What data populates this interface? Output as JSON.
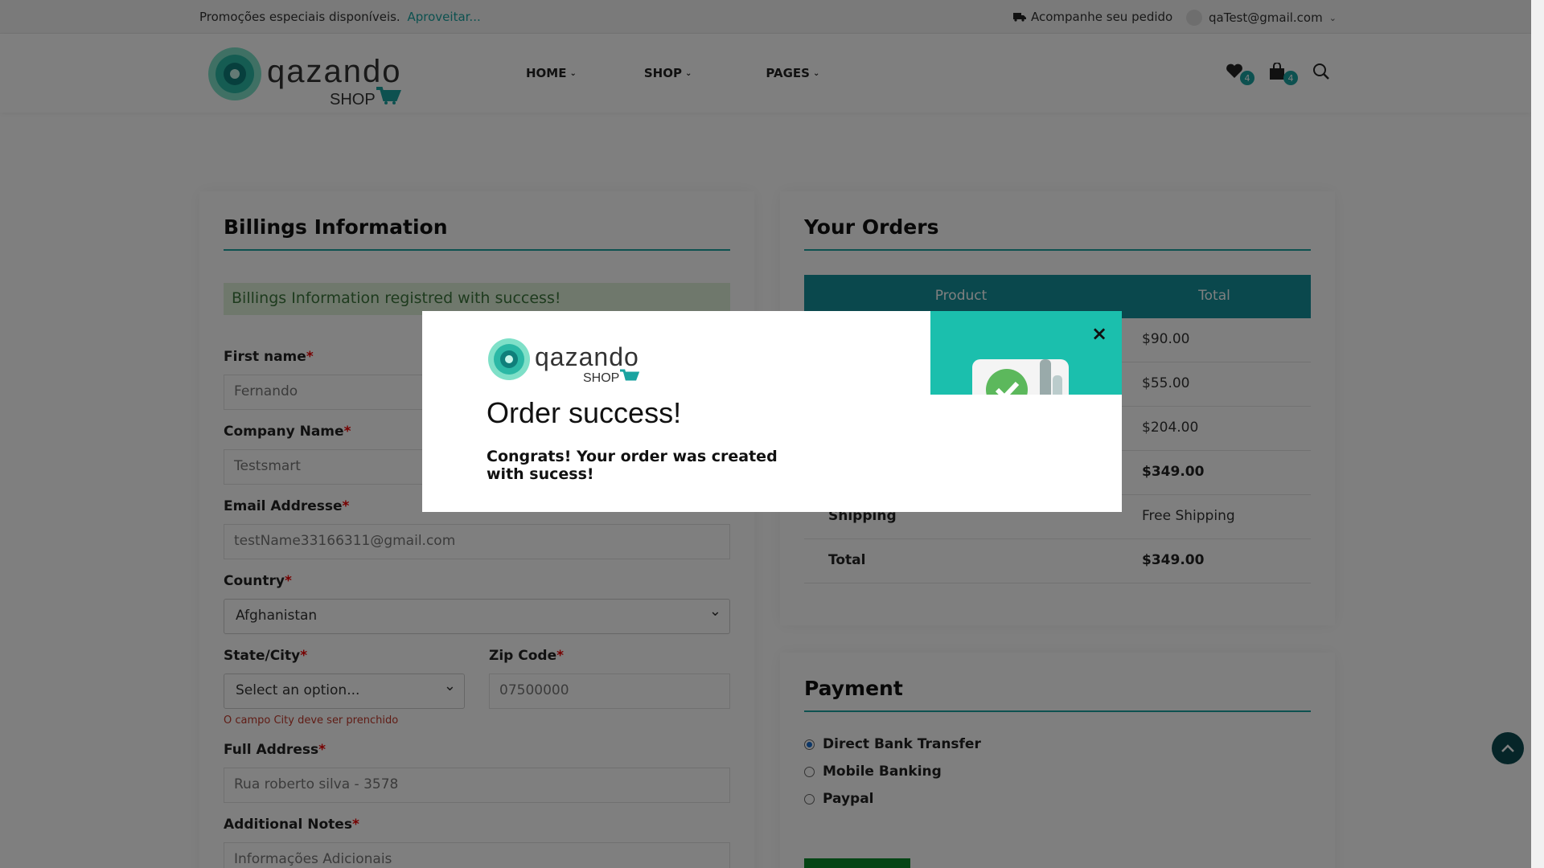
{
  "topbar": {
    "promo_text": "Promoções especiais disponíveis.",
    "promo_link": "Aproveitar...",
    "track_order": "Acompanhe seu pedido",
    "user_email": "qaTest@gmail.com"
  },
  "header": {
    "logo_text": "Qazando",
    "logo_sub": "SHOP",
    "nav": [
      "HOME",
      "SHOP",
      "PAGES"
    ],
    "wishlist_count": "4",
    "cart_count": "4"
  },
  "billing": {
    "title": "Billings Information",
    "success_message": "Billings Information registred with success!",
    "first_name_label": "First name",
    "first_name_value": "Fernando",
    "company_label": "Company Name",
    "company_value": "Testsmart",
    "email_label": "Email Addresse",
    "email_value": "testName33166311@gmail.com",
    "country_label": "Country",
    "country_value": "Afghanistan",
    "state_label": "State/City",
    "state_value": "Select an option...",
    "state_error": "O campo City deve ser prenchido",
    "zip_label": "Zip Code",
    "zip_value": "07500000",
    "address_label": "Full Address",
    "address_value": "Rua roberto silva - 3578",
    "notes_label": "Additional Notes",
    "notes_placeholder": "Informações Adicionais",
    "required_mark": "*"
  },
  "orders": {
    "title": "Your Orders",
    "col_product": "Product",
    "col_total": "Total",
    "rows": [
      {
        "name": "",
        "value": "$90.00"
      },
      {
        "name": "",
        "value": "$55.00"
      },
      {
        "name": "",
        "value": "$204.00"
      },
      {
        "name": "",
        "value": "$349.00"
      },
      {
        "name": "Shipping",
        "value": "Free Shipping"
      },
      {
        "name": "Total",
        "value": "$349.00"
      }
    ]
  },
  "payment": {
    "title": "Payment",
    "options": [
      "Direct Bank Transfer",
      "Mobile Banking",
      "Paypal"
    ],
    "selected": "Direct Bank Transfer"
  },
  "modal": {
    "title": "Order success!",
    "message": "Congrats! Your order was created with sucess!",
    "close": "×"
  },
  "colors": {
    "accent": "#1aa3a0",
    "table_header": "#14919a",
    "success_bg": "#dff0d8",
    "success_text": "#3c763d",
    "error": "#c0392b",
    "modal_image_bg": "#1bbfad"
  }
}
